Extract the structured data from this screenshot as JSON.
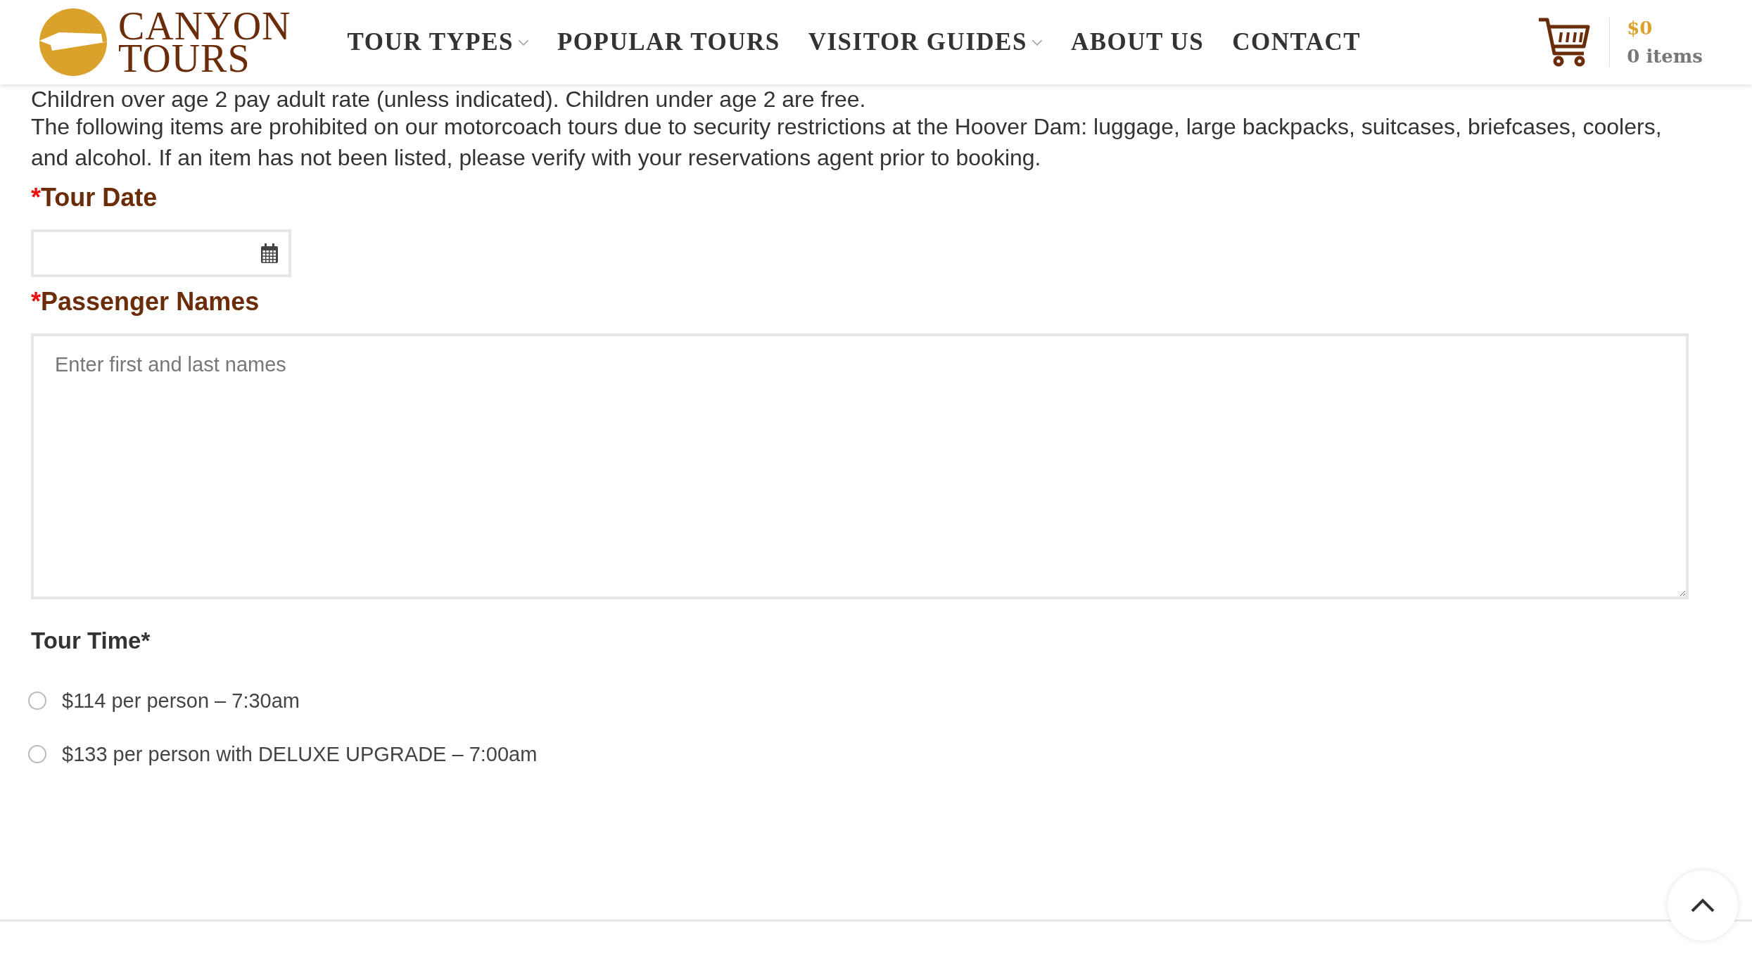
{
  "header": {
    "logo": {
      "line_1": "CANYON",
      "line_2": "TOURS"
    },
    "nav": [
      {
        "label": "TOUR TYPES",
        "dropdown": true
      },
      {
        "label": "POPULAR TOURS",
        "dropdown": false
      },
      {
        "label": "VISITOR GUIDES",
        "dropdown": true
      },
      {
        "label": "ABOUT US",
        "dropdown": false
      },
      {
        "label": "CONTACT",
        "dropdown": false
      }
    ],
    "cart": {
      "total": "$0",
      "count": "0 items"
    }
  },
  "notes": [
    "Children over age 2 pay adult rate (unless indicated). Children under age 2 are free.",
    "The following items are prohibited on our motorcoach tours due to security restrictions at the Hoover Dam: luggage, large backpacks, suitcases, briefcases, coolers, and alcohol. If an item has not been listed, please verify with your reservations agent prior to booking."
  ],
  "tour_date": {
    "required_mark": "*",
    "label": "Tour Date"
  },
  "passenger_names": {
    "required_mark": "*",
    "label": "Passenger Names",
    "placeholder": "Enter first and last names"
  },
  "tour_time": {
    "label": "Tour Time*",
    "options": [
      {
        "label": "$114 per person – 7:30am",
        "selected": false
      },
      {
        "label": "$133 per person with DELUXE UPGRADE – 7:00am",
        "selected": false
      }
    ]
  }
}
